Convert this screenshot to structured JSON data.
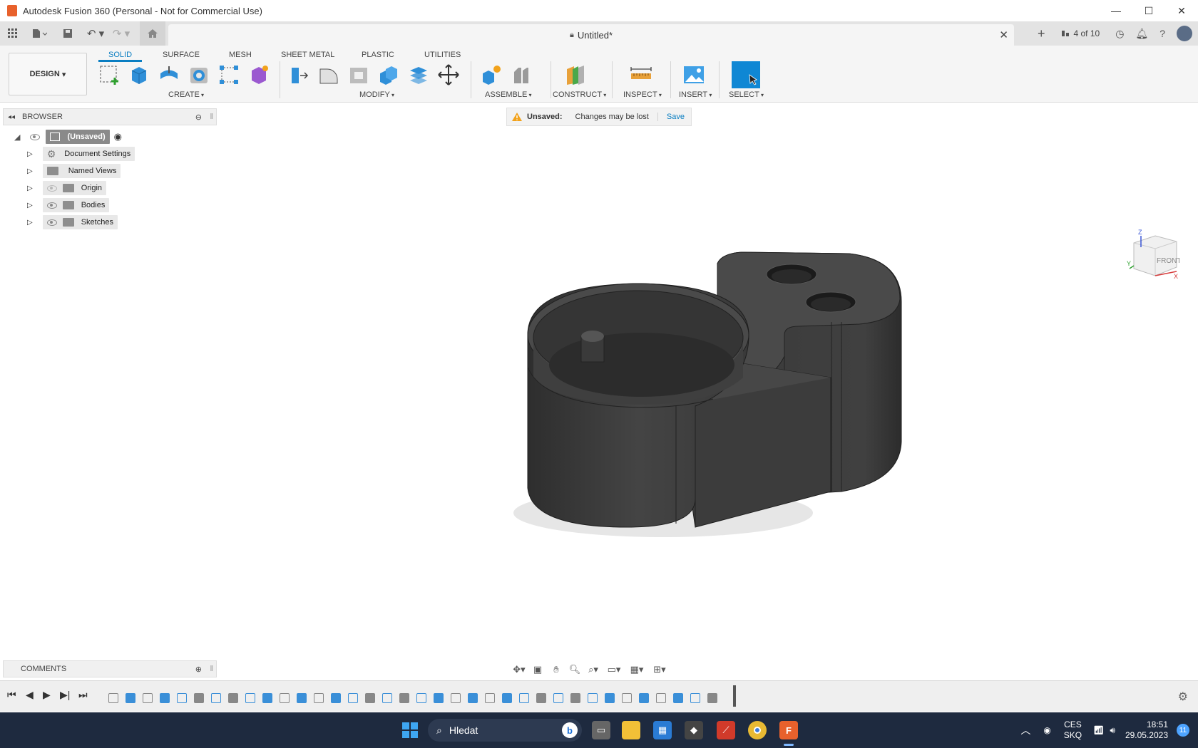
{
  "window": {
    "title": "Autodesk Fusion 360 (Personal - Not for Commercial Use)"
  },
  "tabs": {
    "doc_title": "Untitled*",
    "count": "4 of 10"
  },
  "ribbon": {
    "workspace": "DESIGN",
    "tabs": [
      "SOLID",
      "SURFACE",
      "MESH",
      "SHEET METAL",
      "PLASTIC",
      "UTILITIES"
    ],
    "groups": {
      "create": "CREATE",
      "modify": "MODIFY",
      "assemble": "ASSEMBLE",
      "construct": "CONSTRUCT",
      "inspect": "INSPECT",
      "insert": "INSERT",
      "select": "SELECT"
    }
  },
  "browser": {
    "title": "BROWSER",
    "root": "(Unsaved)",
    "items": [
      "Document Settings",
      "Named Views",
      "Origin",
      "Bodies",
      "Sketches"
    ]
  },
  "unsaved_bar": {
    "label": "Unsaved:",
    "message": "Changes may be lost",
    "action": "Save"
  },
  "viewcube": {
    "face": "FRONT",
    "axis_z": "Z",
    "axis_x": "X",
    "axis_y": "Y"
  },
  "comments": {
    "title": "COMMENTS"
  },
  "taskbar": {
    "search_placeholder": "Hledat",
    "lang_top": "CES",
    "lang_bottom": "SKQ",
    "time": "18:51",
    "date": "29.05.2023",
    "notifications": "11"
  },
  "colors": {
    "accent": "#0a7ec2",
    "body": "#3e3e3e",
    "taskbar": "#1e2a3f"
  }
}
